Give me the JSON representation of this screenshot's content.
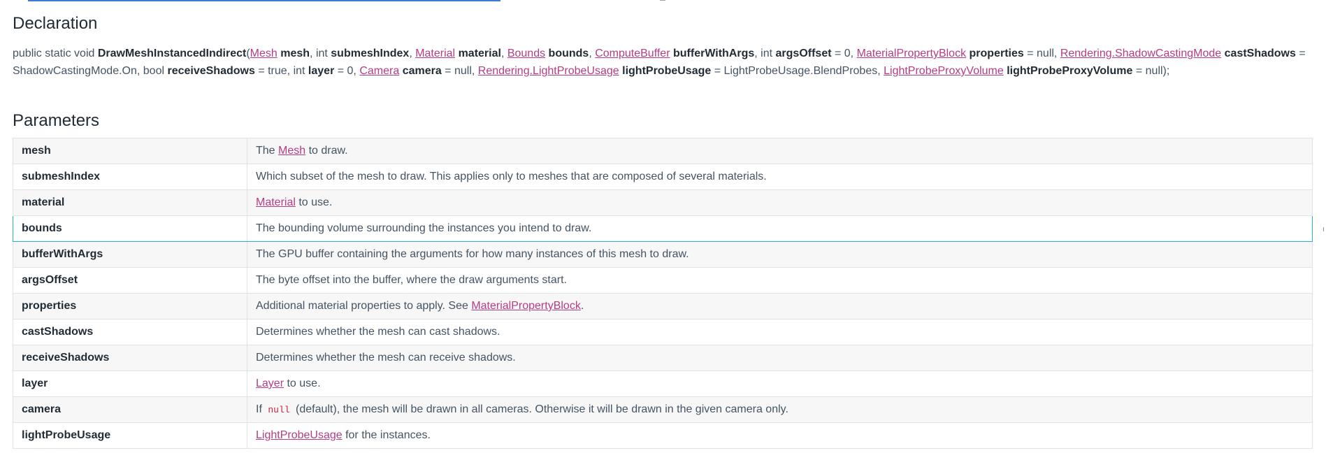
{
  "declaration": {
    "heading": "Declaration",
    "signature": [
      {
        "t": "text",
        "v": "public static void "
      },
      {
        "t": "bold",
        "v": "DrawMeshInstancedIndirect"
      },
      {
        "t": "text",
        "v": "("
      },
      {
        "t": "link",
        "v": "Mesh"
      },
      {
        "t": "text",
        "v": " "
      },
      {
        "t": "bold",
        "v": "mesh"
      },
      {
        "t": "text",
        "v": ", int "
      },
      {
        "t": "bold",
        "v": "submeshIndex"
      },
      {
        "t": "text",
        "v": ", "
      },
      {
        "t": "link",
        "v": "Material"
      },
      {
        "t": "text",
        "v": " "
      },
      {
        "t": "bold",
        "v": "material"
      },
      {
        "t": "text",
        "v": ", "
      },
      {
        "t": "link",
        "v": "Bounds"
      },
      {
        "t": "text",
        "v": " "
      },
      {
        "t": "bold",
        "v": "bounds"
      },
      {
        "t": "text",
        "v": ", "
      },
      {
        "t": "link",
        "v": "ComputeBuffer"
      },
      {
        "t": "text",
        "v": " "
      },
      {
        "t": "bold",
        "v": "bufferWithArgs"
      },
      {
        "t": "text",
        "v": ", int "
      },
      {
        "t": "bold",
        "v": "argsOffset"
      },
      {
        "t": "text",
        "v": " = 0, "
      },
      {
        "t": "link",
        "v": "MaterialPropertyBlock"
      },
      {
        "t": "text",
        "v": " "
      },
      {
        "t": "bold",
        "v": "properties"
      },
      {
        "t": "text",
        "v": " = null, "
      },
      {
        "t": "link",
        "v": "Rendering.ShadowCastingMode"
      },
      {
        "t": "text",
        "v": " "
      },
      {
        "t": "bold",
        "v": "castShadows"
      },
      {
        "t": "text",
        "v": " = ShadowCastingMode.On, bool "
      },
      {
        "t": "bold",
        "v": "receiveShadows"
      },
      {
        "t": "text",
        "v": " = true, int "
      },
      {
        "t": "bold",
        "v": "layer"
      },
      {
        "t": "text",
        "v": " = 0, "
      },
      {
        "t": "link",
        "v": "Camera"
      },
      {
        "t": "text",
        "v": " "
      },
      {
        "t": "bold",
        "v": "camera"
      },
      {
        "t": "text",
        "v": " = null, "
      },
      {
        "t": "link",
        "v": "Rendering.LightProbeUsage"
      },
      {
        "t": "text",
        "v": " "
      },
      {
        "t": "bold",
        "v": "lightProbeUsage"
      },
      {
        "t": "text",
        "v": " = LightProbeUsage.BlendProbes, "
      },
      {
        "t": "link",
        "v": "LightProbeProxyVolume"
      },
      {
        "t": "text",
        "v": " "
      },
      {
        "t": "bold",
        "v": "lightProbeProxyVolume"
      },
      {
        "t": "text",
        "v": " = null);"
      }
    ]
  },
  "parameters": {
    "heading": "Parameters",
    "rows": [
      {
        "name": "mesh",
        "desc": [
          {
            "t": "text",
            "v": "The "
          },
          {
            "t": "link",
            "v": "Mesh"
          },
          {
            "t": "text",
            "v": " to draw."
          }
        ]
      },
      {
        "name": "submeshIndex",
        "desc": [
          {
            "t": "text",
            "v": "Which subset of the mesh to draw. This applies only to meshes that are composed of several materials."
          }
        ]
      },
      {
        "name": "material",
        "desc": [
          {
            "t": "link",
            "v": "Material"
          },
          {
            "t": "text",
            "v": " to use."
          }
        ]
      },
      {
        "name": "bounds",
        "focused": true,
        "desc": [
          {
            "t": "text",
            "v": "The bounding volume surrounding the instances you intend to draw."
          }
        ]
      },
      {
        "name": "bufferWithArgs",
        "desc": [
          {
            "t": "text",
            "v": "The GPU buffer containing the arguments for how many instances of this mesh to draw."
          }
        ]
      },
      {
        "name": "argsOffset",
        "desc": [
          {
            "t": "text",
            "v": "The byte offset into the buffer, where the draw arguments start."
          }
        ]
      },
      {
        "name": "properties",
        "desc": [
          {
            "t": "text",
            "v": "Additional material properties to apply. See "
          },
          {
            "t": "link",
            "v": "MaterialPropertyBlock"
          },
          {
            "t": "text",
            "v": "."
          }
        ]
      },
      {
        "name": "castShadows",
        "desc": [
          {
            "t": "text",
            "v": "Determines whether the mesh can cast shadows."
          }
        ]
      },
      {
        "name": "receiveShadows",
        "desc": [
          {
            "t": "text",
            "v": "Determines whether the mesh can receive shadows."
          }
        ]
      },
      {
        "name": "layer",
        "desc": [
          {
            "t": "link",
            "v": "Layer"
          },
          {
            "t": "text",
            "v": " to use."
          }
        ]
      },
      {
        "name": "camera",
        "desc": [
          {
            "t": "text",
            "v": "If "
          },
          {
            "t": "code",
            "v": "null"
          },
          {
            "t": "text",
            "v": " (default), the mesh will be drawn in all cameras. Otherwise it will be drawn in the given camera only."
          }
        ]
      },
      {
        "name": "lightProbeUsage",
        "desc": [
          {
            "t": "link",
            "v": "LightProbeUsage"
          },
          {
            "t": "text",
            "v": " for the instances."
          }
        ]
      }
    ]
  },
  "colors": {
    "link": "#b53c85",
    "focus_outline": "#2bb3c0",
    "code": "#c8223a"
  }
}
